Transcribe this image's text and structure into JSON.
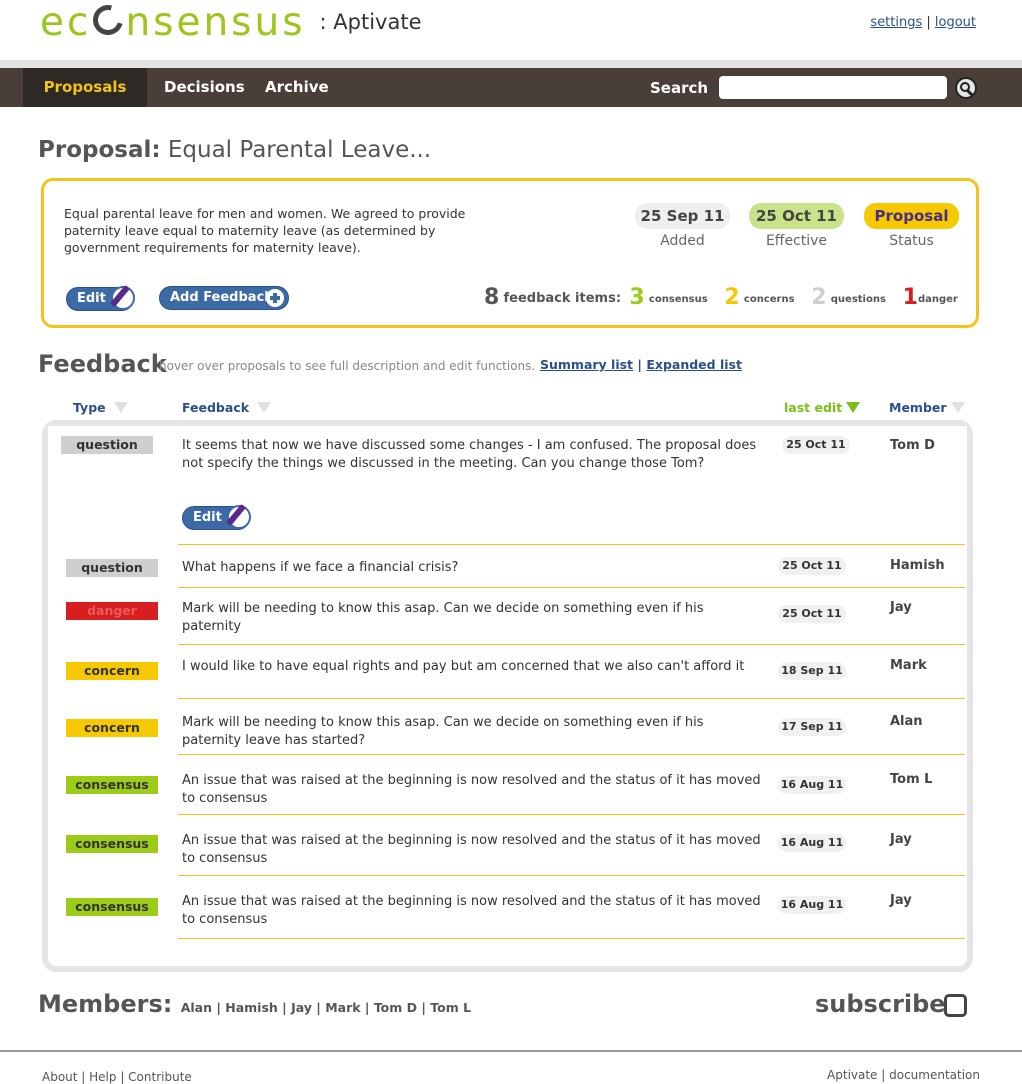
{
  "logo": {
    "text_before": "ec",
    "text_after": "nsensus",
    "suffix": ": Aptivate"
  },
  "top_links": {
    "settings": "settings",
    "separator": "|",
    "logout": "logout"
  },
  "nav": {
    "items": [
      "Proposals",
      "Decisions",
      "Archive"
    ],
    "active": "Proposals",
    "search_label": "Search",
    "search_value": ""
  },
  "proposal": {
    "heading": "Proposal:",
    "title": "Equal Parental Leave...",
    "description": "Equal parental leave for men and women. We agreed to provide paternity leave equal to maternity leave (as determined by government requirements for maternity leave).",
    "added_date": "25 Sep 11",
    "added_label": "Added",
    "effective_date": "25 Oct 11",
    "effective_label": "Effective",
    "status_value": "Proposal",
    "status_label": "Status",
    "edit_label": "Edit",
    "add_feedback_label": "Add Feedback",
    "feedback_count": "8",
    "feedback_items_label": "feedback items:",
    "consensus_count": "3",
    "consensus_label": "consensus",
    "concerns_count": "2",
    "concerns_label": "concerns",
    "questions_count": "2",
    "questions_label": "questions",
    "danger_count": "1",
    "danger_label": "danger",
    "colors": {
      "border": "#f5c11a",
      "added_bg": "#efefef",
      "effective_bg": "#c9e38a",
      "status_bg": "#f5c800"
    }
  },
  "feedback": {
    "heading": "Feedback",
    "hint": "hover over proposals to see full description and edit functions.",
    "summary_link": "Summary list",
    "link_separator": "|",
    "expanded_link": "Expanded list",
    "columns": {
      "type": "Type",
      "feedback": "Feedback",
      "last_edit": "last edit",
      "member": "Member"
    },
    "edit_label": "Edit",
    "rows": [
      {
        "type": "question",
        "text": "It seems that now we have discussed some changes - I am confused. The proposal does not specify the things we discussed in the meeting. Can you change those Tom?",
        "date": "25 Oct 11",
        "member": "Tom D"
      },
      {
        "type": "question",
        "text": "What happens if we face a financial crisis?",
        "date": "25 Oct 11",
        "member": "Hamish"
      },
      {
        "type": "danger",
        "text": "Mark will be needing to know this asap. Can we decide on something even if his paternity",
        "date": "25 Oct 11",
        "member": "Jay"
      },
      {
        "type": "concern",
        "text": "I would like to have equal rights and pay but am concerned that we also can't afford it",
        "date": "18 Sep 11",
        "member": "Mark"
      },
      {
        "type": "concern",
        "text": "Mark will be needing to know this asap. Can we decide on something even if his paternity leave has started?",
        "date": "17 Sep 11",
        "member": "Alan"
      },
      {
        "type": "consensus",
        "text": "An issue that was raised at the beginning is now resolved and the status of it has moved to consensus",
        "date": "16 Aug 11",
        "member": "Tom L"
      },
      {
        "type": "consensus",
        "text": "An issue that was raised at the beginning is now resolved and the status of it has moved to consensus",
        "date": "16 Aug 11",
        "member": "Jay"
      },
      {
        "type": "consensus",
        "text": "An issue that was raised at the beginning is now resolved and the status of it has moved to consensus",
        "date": "16 Aug 11",
        "member": "Jay"
      }
    ]
  },
  "members": {
    "heading": "Members:",
    "list": "Alan | Hamish | Jay | Mark | Tom D | Tom L"
  },
  "subscribe": {
    "label": "subscribe:",
    "checked": false
  },
  "footer": {
    "left": "About | Help | Contribute",
    "right": "Aptivate | documentation"
  }
}
